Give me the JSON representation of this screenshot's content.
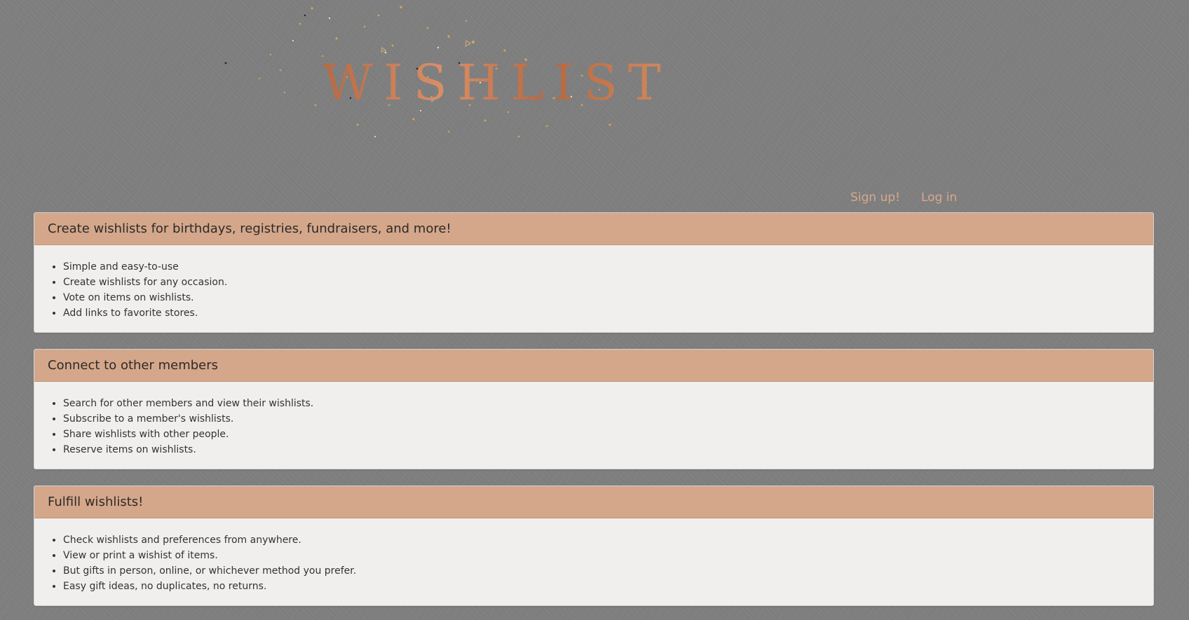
{
  "logo": {
    "text": "WISHLIST",
    "color": "#c8794f"
  },
  "nav": {
    "signup": "Sign up!",
    "login": "Log in",
    "link_color": "#d6a98c"
  },
  "panels": [
    {
      "title": "Create wishlists for birthdays, registries, fundraisers, and more!",
      "items": [
        "Simple and easy-to-use",
        "Create wishlists for any occasion.",
        "Vote on items on wishlists.",
        "Add links to favorite stores."
      ]
    },
    {
      "title": "Connect to other members",
      "items": [
        "Search for other members and view their wishlists.",
        "Subscribe to a member's wishlists.",
        "Share wishlists with other people.",
        "Reserve items on wishlists."
      ]
    },
    {
      "title": "Fulfill wishlists!",
      "items": [
        "Check wishlists and preferences from anywhere.",
        "View or print a wishist of items.",
        "But gifts in person, online, or whichever method you prefer.",
        "Easy gift ideas, no duplicates, no returns."
      ]
    }
  ],
  "colors": {
    "page_background": "#7e7e7e",
    "panel_header": "#d4a78b",
    "panel_body": "#f0efed",
    "text": "#333333"
  }
}
